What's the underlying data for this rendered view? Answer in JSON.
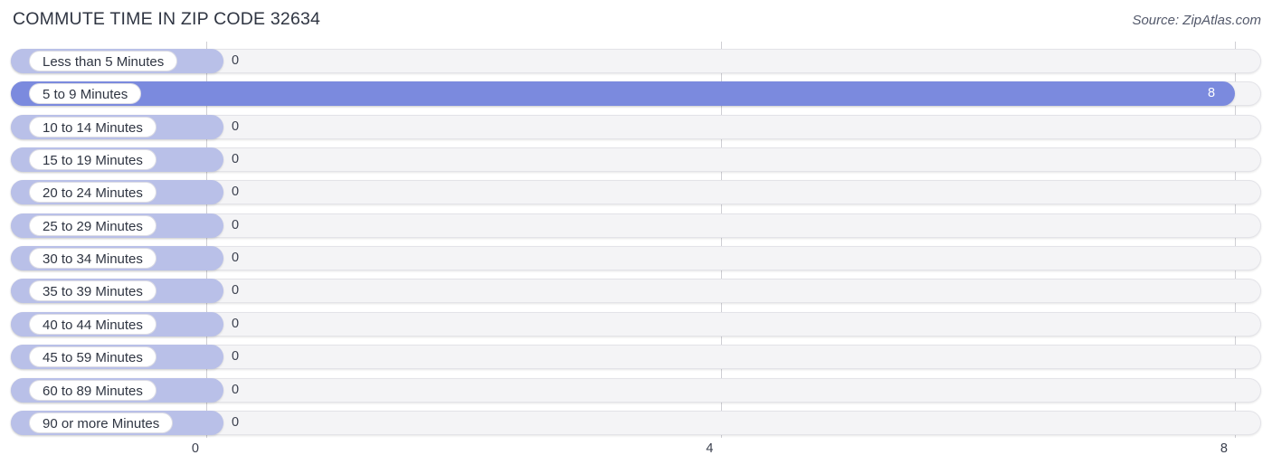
{
  "header": {
    "title": "COMMUTE TIME IN ZIP CODE 32634",
    "source": "Source: ZipAtlas.com"
  },
  "chart_data": {
    "type": "bar",
    "orientation": "horizontal",
    "title": "COMMUTE TIME IN ZIP CODE 32634",
    "source": "Source: ZipAtlas.com",
    "xlabel": "",
    "ylabel": "",
    "xlim": [
      0,
      8
    ],
    "grid": true,
    "legend": null,
    "axis_ticks": [
      {
        "label": "0",
        "value": 0
      },
      {
        "label": "4",
        "value": 4
      },
      {
        "label": "8",
        "value": 8
      }
    ],
    "categories": [
      "Less than 5 Minutes",
      "5 to 9 Minutes",
      "10 to 14 Minutes",
      "15 to 19 Minutes",
      "20 to 24 Minutes",
      "25 to 29 Minutes",
      "30 to 34 Minutes",
      "35 to 39 Minutes",
      "40 to 44 Minutes",
      "45 to 59 Minutes",
      "60 to 89 Minutes",
      "90 or more Minutes"
    ],
    "values": [
      0,
      8,
      0,
      0,
      0,
      0,
      0,
      0,
      0,
      0,
      0,
      0
    ],
    "value_labels": [
      "0",
      "8",
      "0",
      "0",
      "0",
      "0",
      "0",
      "0",
      "0",
      "0",
      "0",
      "0"
    ],
    "colors": {
      "bar": "#b9c0e8",
      "bar_highlight": "#7b8ade",
      "track": "#f4f4f6",
      "track_border": "#e3e3e8",
      "gridline": "#cfcfd4",
      "text": "#2f3542",
      "value_inside": "#ffffff"
    },
    "highlight_index": 1
  }
}
